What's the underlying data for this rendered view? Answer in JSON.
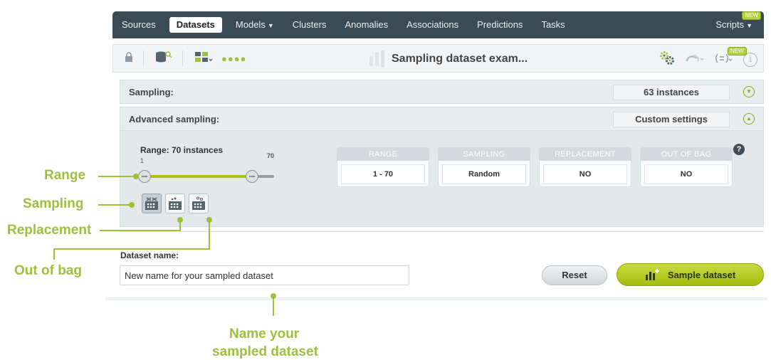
{
  "nav": {
    "items": [
      {
        "label": "Sources"
      },
      {
        "label": "Datasets",
        "active": true
      },
      {
        "label": "Models",
        "caret": true
      },
      {
        "label": "Clusters"
      },
      {
        "label": "Anomalies"
      },
      {
        "label": "Associations"
      },
      {
        "label": "Predictions"
      },
      {
        "label": "Tasks"
      }
    ],
    "scripts_label": "Scripts",
    "new_badge": "NEW"
  },
  "toolbar": {
    "title": "Sampling dataset exam...",
    "new_badge": "NEW",
    "icons": [
      "lock-icon",
      "dataset-search-icon",
      "dataset-filter-icon",
      "more-dots-icon",
      "gears-icon",
      "cluster-icon",
      "list-icon",
      "info-icon"
    ]
  },
  "sampling": {
    "label": "Sampling:",
    "summary": "63 instances"
  },
  "advanced": {
    "label": "Advanced sampling:",
    "summary": "Custom settings",
    "range_title": "Range: 70 instances",
    "range_min": "1",
    "range_max": "70",
    "range_fill_fraction": 0.83,
    "sampling_mode_active": 0,
    "cards": [
      {
        "header": "RANGE",
        "value": "1 - 70"
      },
      {
        "header": "SAMPLING",
        "value": "Random"
      },
      {
        "header": "REPLACEMENT",
        "value": "NO"
      },
      {
        "header": "OUT OF BAG",
        "value": "NO"
      }
    ],
    "help": "?"
  },
  "dataset_name": {
    "label": "Dataset name:",
    "value": "New name for your sampled dataset"
  },
  "buttons": {
    "reset": "Reset",
    "sample": "Sample dataset"
  },
  "annotations": {
    "range": "Range",
    "sampling": "Sampling",
    "replacement": "Replacement",
    "out_of_bag": "Out of bag",
    "name_line1": "Name your",
    "name_line2": "sampled dataset"
  },
  "colors": {
    "accent": "#9dc13b",
    "nav_bg": "#3a4b55",
    "button_green": "#b4cc1c"
  }
}
